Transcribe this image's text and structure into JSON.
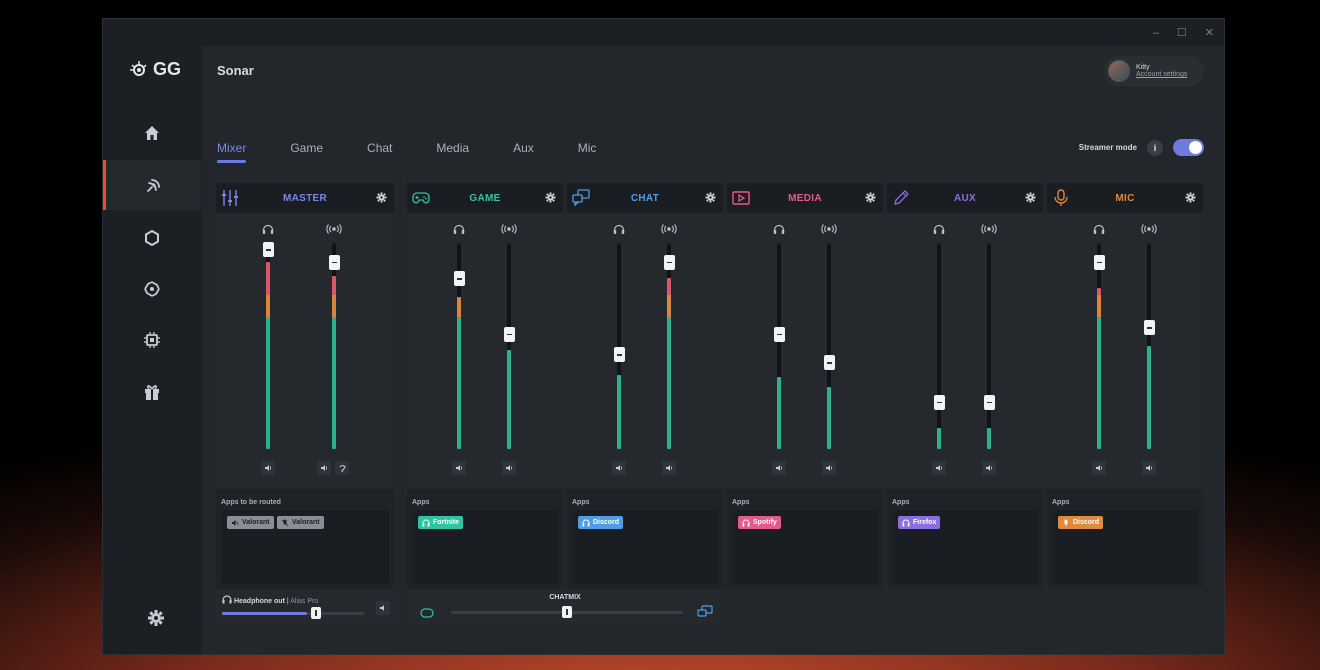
{
  "window": {
    "controls": [
      "–",
      "☐",
      "✕"
    ]
  },
  "brand": {
    "name": "GG"
  },
  "app": {
    "title": "Sonar"
  },
  "account": {
    "name": "Kitty",
    "link": "Account settings"
  },
  "nav": [
    {
      "icon": "home-icon"
    },
    {
      "icon": "sonar-icon",
      "active": true
    },
    {
      "icon": "hexagon-icon"
    },
    {
      "icon": "engine-icon"
    },
    {
      "icon": "chip-icon"
    },
    {
      "icon": "gift-icon"
    },
    {
      "icon": "settings-icon"
    }
  ],
  "tabs": [
    "Mixer",
    "Game",
    "Chat",
    "Media",
    "Aux",
    "Mic"
  ],
  "active_tab": "Mixer",
  "streamer": {
    "label": "Streamer mode",
    "info": "i",
    "enabled": true
  },
  "colors": {
    "accent": "#6f7ae0",
    "master": "#7b86e8",
    "game": "#2fc4a0",
    "chat": "#4d9ee6",
    "media": "#e65a8a",
    "aux": "#8a6fe0",
    "mic": "#e08a3c",
    "level": "#26b38f",
    "level_warn": "#d9853c",
    "level_peak": "#d9566a"
  },
  "channels": [
    {
      "name": "MASTER",
      "icon": "sliders-icon",
      "apps_label": "Apps to be routed",
      "apps": [
        {
          "name": "Valorant",
          "icon": "mute-icon"
        },
        {
          "name": "Valorant",
          "icon": "mic-off-icon"
        }
      ],
      "headphone_level": 0.97,
      "stream_level": 0.91,
      "headphone_fill": 0.91,
      "stream_fill": 0.84
    },
    {
      "name": "GAME",
      "icon": "gamepad-icon",
      "apps_label": "Apps",
      "apps": [
        {
          "name": "Fortnite",
          "icon": "headphone-icon"
        }
      ],
      "headphone_level": 0.83,
      "stream_level": 0.56,
      "headphone_fill": 0.74,
      "stream_fill": 0.48
    },
    {
      "name": "CHAT",
      "icon": "chat-icon",
      "apps_label": "Apps",
      "apps": [
        {
          "name": "Discord",
          "icon": "headphone-icon"
        }
      ],
      "headphone_level": 0.46,
      "stream_level": 0.91,
      "headphone_fill": 0.36,
      "stream_fill": 0.83
    },
    {
      "name": "MEDIA",
      "icon": "play-icon",
      "apps_label": "Apps",
      "apps": [
        {
          "name": "Spotify",
          "icon": "headphone-icon"
        }
      ],
      "headphone_level": 0.56,
      "stream_level": 0.42,
      "headphone_fill": 0.35,
      "stream_fill": 0.3
    },
    {
      "name": "AUX",
      "icon": "pen-icon",
      "apps_label": "Apps",
      "apps": [
        {
          "name": "Firefox",
          "icon": "headphone-icon"
        }
      ],
      "headphone_level": 0.23,
      "stream_level": 0.23,
      "headphone_fill": 0.1,
      "stream_fill": 0.1
    },
    {
      "name": "MIC",
      "icon": "mic-icon",
      "apps_label": "Apps",
      "apps": [
        {
          "name": "Discord",
          "icon": "mic-icon"
        }
      ],
      "headphone_level": 0.91,
      "stream_level": 0.59,
      "headphone_fill": 0.78,
      "stream_fill": 0.5
    }
  ],
  "output": {
    "label": "Headphone out",
    "device": "Alias Pro",
    "volume": 0.6
  },
  "chatmix": {
    "label": "CHATMIX",
    "value": 0.5
  }
}
